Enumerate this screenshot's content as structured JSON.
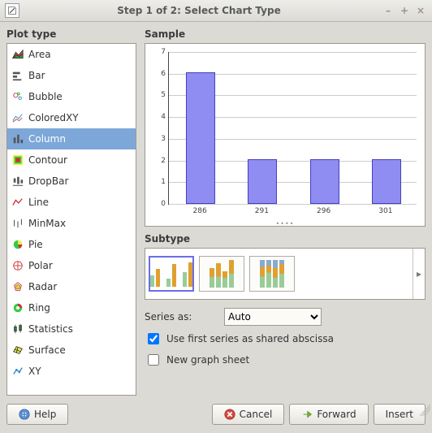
{
  "window": {
    "title": "Step 1 of 2: Select Chart Type"
  },
  "left_panel": {
    "title": "Plot type",
    "items": [
      {
        "label": "Area",
        "icon": "area"
      },
      {
        "label": "Bar",
        "icon": "bar"
      },
      {
        "label": "Bubble",
        "icon": "bubble"
      },
      {
        "label": "ColoredXY",
        "icon": "coloredxy"
      },
      {
        "label": "Column",
        "icon": "column",
        "selected": true
      },
      {
        "label": "Contour",
        "icon": "contour"
      },
      {
        "label": "DropBar",
        "icon": "dropbar"
      },
      {
        "label": "Line",
        "icon": "line"
      },
      {
        "label": "MinMax",
        "icon": "minmax"
      },
      {
        "label": "Pie",
        "icon": "pie"
      },
      {
        "label": "Polar",
        "icon": "polar"
      },
      {
        "label": "Radar",
        "icon": "radar"
      },
      {
        "label": "Ring",
        "icon": "ring"
      },
      {
        "label": "Statistics",
        "icon": "statistics"
      },
      {
        "label": "Surface",
        "icon": "surface"
      },
      {
        "label": "XY",
        "icon": "xy"
      }
    ]
  },
  "sample": {
    "title": "Sample"
  },
  "chart_data": {
    "type": "bar",
    "categories": [
      "286",
      "291",
      "296",
      "301"
    ],
    "values": [
      6,
      2,
      2,
      2
    ],
    "title": "",
    "xlabel": "",
    "ylabel": "",
    "ylim": [
      0,
      7
    ],
    "yticks": [
      0,
      1,
      2,
      3,
      4,
      5,
      6,
      7
    ]
  },
  "subtype": {
    "title": "Subtype",
    "selected": 0,
    "thumbs": [
      "side-by-side",
      "stacked",
      "percentage"
    ]
  },
  "form": {
    "series_as_label": "Series as:",
    "series_as_value": "Auto",
    "use_first_series_label": "Use first series as shared abscissa",
    "use_first_series_checked": true,
    "new_graph_sheet_label": "New graph sheet",
    "new_graph_sheet_checked": false
  },
  "buttons": {
    "help": "Help",
    "cancel": "Cancel",
    "forward": "Forward",
    "insert": "Insert"
  }
}
